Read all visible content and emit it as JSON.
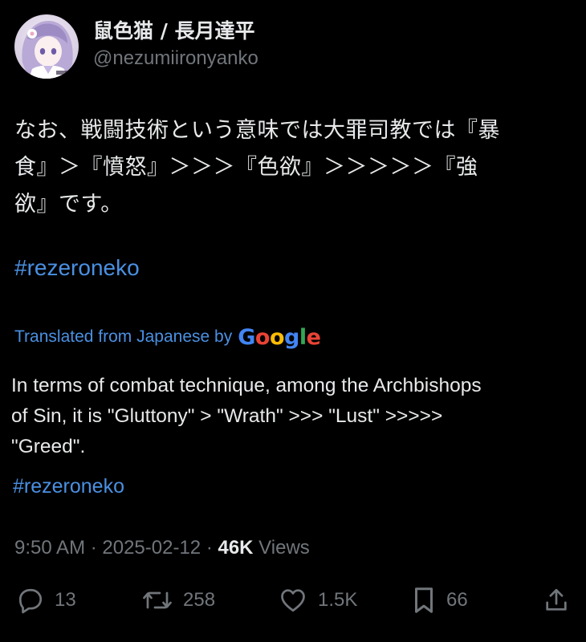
{
  "user": {
    "display_name": "鼠色猫 / 長月達平",
    "handle": "@nezumiironyanko"
  },
  "tweet": {
    "text_jp": "なお、戦闘技術という意味では大罪司教では『暴\n食』＞『憤怒』＞＞＞『色欲』＞＞＞＞＞『強\n欲』です。",
    "hashtag_jp": "#rezeroneko",
    "translated_label": "Translated from Japanese by",
    "translation_provider": "Google",
    "text_en": "In terms of combat technique, among the Archbishops\nof Sin, it is \"Gluttony\" > \"Wrath\" >>> \"Lust\" >>>>>\n\"Greed\".",
    "hashtag_en": "#rezeroneko"
  },
  "meta": {
    "time": "9:50 AM",
    "sep1": " · ",
    "date": "2025-02-12",
    "sep2": " · ",
    "views_count": "46K",
    "views_label": " Views"
  },
  "actions": {
    "reply_count": "13",
    "retweet_count": "258",
    "like_count": "1.5K",
    "bookmark_count": "66"
  },
  "icons": {
    "reply": "reply-icon",
    "retweet": "retweet-icon",
    "like": "heart-icon",
    "bookmark": "bookmark-icon",
    "share": "share-icon"
  },
  "colors": {
    "background": "#000000",
    "text": "#e7e9ea",
    "muted": "#71767b",
    "link": "#4a90e2"
  }
}
